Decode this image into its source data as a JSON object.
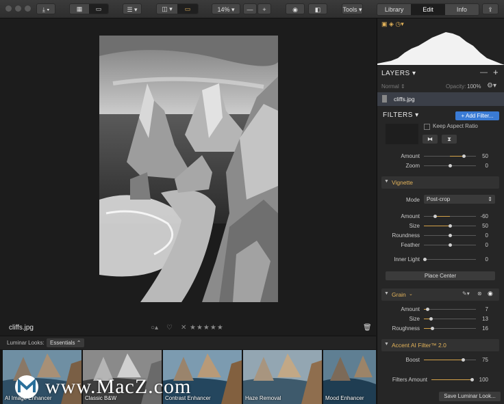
{
  "toolbar": {
    "zoom_label": "14%",
    "zoom_minus": "—",
    "zoom_plus": "+",
    "tools_label": "Tools",
    "tabs": [
      {
        "label": "Library"
      },
      {
        "label": "Edit"
      },
      {
        "label": "Info"
      }
    ]
  },
  "canvas": {
    "filename": "cliffs.jpg",
    "stars": "★★★★★",
    "reject": "✕"
  },
  "looks": {
    "label": "Luminar Looks:",
    "collection": "Essentials",
    "items": [
      {
        "label": "AI Image Enhancer"
      },
      {
        "label": "Classic B&W"
      },
      {
        "label": "Contrast Enhancer"
      },
      {
        "label": "Haze Removal"
      },
      {
        "label": "Mood Enhancer"
      }
    ]
  },
  "watermark": {
    "text": "www.MacZ.com"
  },
  "layers": {
    "title": "LAYERS",
    "blend": "Normal",
    "opacity_label": "Opacity:",
    "opacity_value": "100%",
    "layer_name": "cliffs.jpg"
  },
  "filters": {
    "title": "FILTERS",
    "add_button": "+ Add Filter...",
    "crop": {
      "keep_aspect": "Keep Aspect Ratio",
      "amount_label": "Amount",
      "amount": "50",
      "zoom_label": "Zoom",
      "zoom": "0"
    },
    "vignette": {
      "title": "Vignette",
      "mode_label": "Mode",
      "mode_value": "Post-crop",
      "rows": [
        {
          "label": "Amount",
          "value": "-60"
        },
        {
          "label": "Size",
          "value": "50"
        },
        {
          "label": "Roundness",
          "value": "0"
        },
        {
          "label": "Feather",
          "value": "0"
        }
      ],
      "inner_light_label": "Inner Light",
      "inner_light": "0",
      "place_center": "Place Center"
    },
    "grain": {
      "title": "Grain",
      "rows": [
        {
          "label": "Amount",
          "value": "7"
        },
        {
          "label": "Size",
          "value": "13"
        },
        {
          "label": "Roughness",
          "value": "16"
        }
      ]
    },
    "accent": {
      "title": "Accent AI Filter™ 2.0",
      "boost_label": "Boost",
      "boost": "75"
    },
    "filters_amount_label": "Filters Amount",
    "filters_amount": "100",
    "save_looks": "Save Luminar Look..."
  }
}
